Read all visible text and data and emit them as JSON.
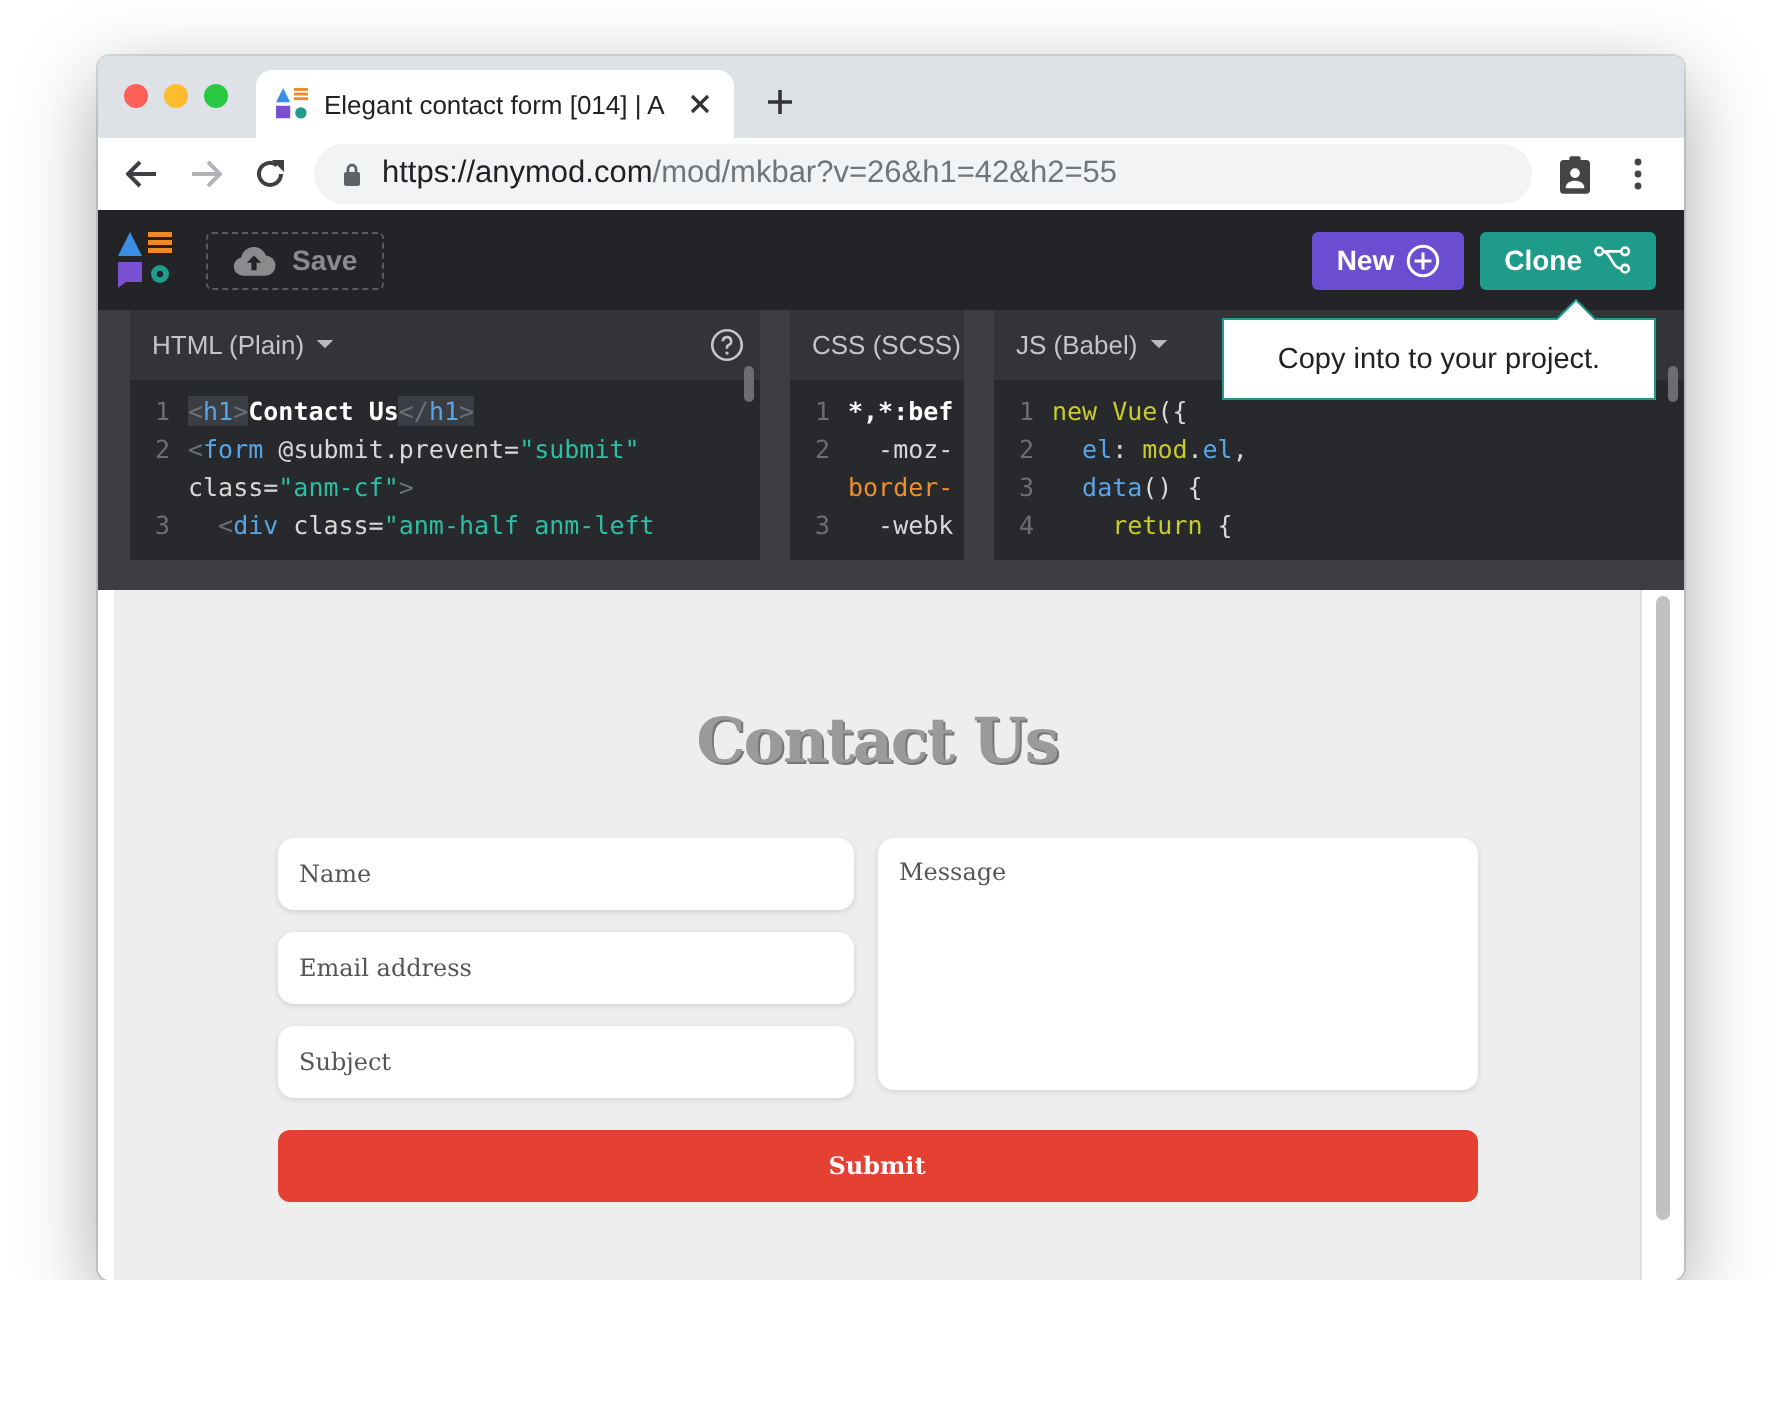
{
  "browser": {
    "tab_title": "Elegant contact form [014] | A",
    "url_host": "https://anymod.com",
    "url_path": "/mod/mkbar?v=26&h1=42&h2=55",
    "nav": [
      {
        "kind": "back",
        "disabled": false
      },
      {
        "kind": "forward",
        "disabled": true
      },
      {
        "kind": "reload",
        "disabled": false
      }
    ]
  },
  "toolbar": {
    "save": "Save",
    "new": "New",
    "clone": "Clone"
  },
  "tooltip": "Copy into to your project.",
  "panes": [
    {
      "title": "HTML (Plain)",
      "help": true,
      "lines": [
        {
          "number": "1",
          "tokens": [
            {
              "t": "<",
              "kind": "punct",
              "matched": true
            },
            {
              "t": "h1",
              "kind": "tag",
              "matched": true
            },
            {
              "t": ">",
              "kind": "punct",
              "matched": true
            },
            {
              "t": "Contact Us",
              "kind": "text",
              "matched": false
            },
            {
              "t": "</",
              "kind": "punct",
              "matched": true
            },
            {
              "t": "h1",
              "kind": "tag",
              "matched": true
            },
            {
              "t": ">",
              "kind": "punct",
              "matched": true
            }
          ]
        },
        {
          "number": "2",
          "tokens": [
            {
              "t": "<",
              "kind": "punct",
              "matched": false
            },
            {
              "t": "form",
              "kind": "tag",
              "matched": false
            },
            {
              "t": " @submit.prevent=",
              "kind": "attr",
              "matched": false
            },
            {
              "t": "\"submit\"",
              "kind": "str",
              "matched": false
            }
          ]
        },
        {
          "tokens": [
            {
              "t": "class=",
              "kind": "attr",
              "matched": false
            },
            {
              "t": "\"anm-cf\"",
              "kind": "str",
              "matched": false
            },
            {
              "t": ">",
              "kind": "punct",
              "matched": false
            }
          ]
        },
        {
          "number": "3",
          "tokens": [
            {
              "t": "  <",
              "kind": "punct",
              "matched": false
            },
            {
              "t": "div",
              "kind": "tag",
              "matched": false
            },
            {
              "t": " class=",
              "kind": "attr",
              "matched": false
            },
            {
              "t": "\"anm-half anm-left",
              "kind": "str",
              "matched": false
            }
          ]
        }
      ]
    },
    {
      "title": "CSS (SCSS)",
      "lines": [
        {
          "number": "1",
          "tokens": [
            {
              "t": "*,*:bef",
              "kind": "text",
              "matched": false
            }
          ]
        },
        {
          "number": "2",
          "tokens": [
            {
              "t": "  -moz-",
              "kind": "attr",
              "matched": false
            }
          ]
        },
        {
          "tokens": [
            {
              "t": "border-",
              "kind": "prop",
              "matched": false
            }
          ]
        },
        {
          "number": "3",
          "tokens": [
            {
              "t": "  -webk",
              "kind": "attr",
              "matched": false
            }
          ]
        }
      ]
    },
    {
      "title": "JS (Babel)",
      "lines": [
        {
          "number": "1",
          "tokens": [
            {
              "t": "new Vue",
              "kind": "kw",
              "matched": false
            },
            {
              "t": "({",
              "kind": "attr",
              "matched": false
            }
          ]
        },
        {
          "number": "2",
          "tokens": [
            {
              "t": "  el",
              "kind": "tag",
              "matched": false
            },
            {
              "t": ": ",
              "kind": "attr",
              "matched": false
            },
            {
              "t": "mod",
              "kind": "kw",
              "matched": false
            },
            {
              "t": ".",
              "kind": "attr",
              "matched": false
            },
            {
              "t": "el",
              "kind": "tag",
              "matched": false
            },
            {
              "t": ",",
              "kind": "attr",
              "matched": false
            }
          ]
        },
        {
          "number": "3",
          "tokens": [
            {
              "t": "  data",
              "kind": "tag",
              "matched": false
            },
            {
              "t": "() {",
              "kind": "attr",
              "matched": false
            }
          ]
        },
        {
          "number": "4",
          "tokens": [
            {
              "t": "    return",
              "kind": "kw",
              "matched": false
            },
            {
              "t": " {",
              "kind": "attr",
              "matched": false
            }
          ]
        }
      ]
    }
  ],
  "preview": {
    "heading": "Contact Us",
    "fields": [
      {
        "kind": "input",
        "placeholder": "Name"
      },
      {
        "kind": "input",
        "placeholder": "Email address"
      },
      {
        "kind": "input",
        "placeholder": "Subject"
      },
      {
        "kind": "textarea",
        "placeholder": "Message"
      }
    ],
    "submit": "Submit"
  }
}
